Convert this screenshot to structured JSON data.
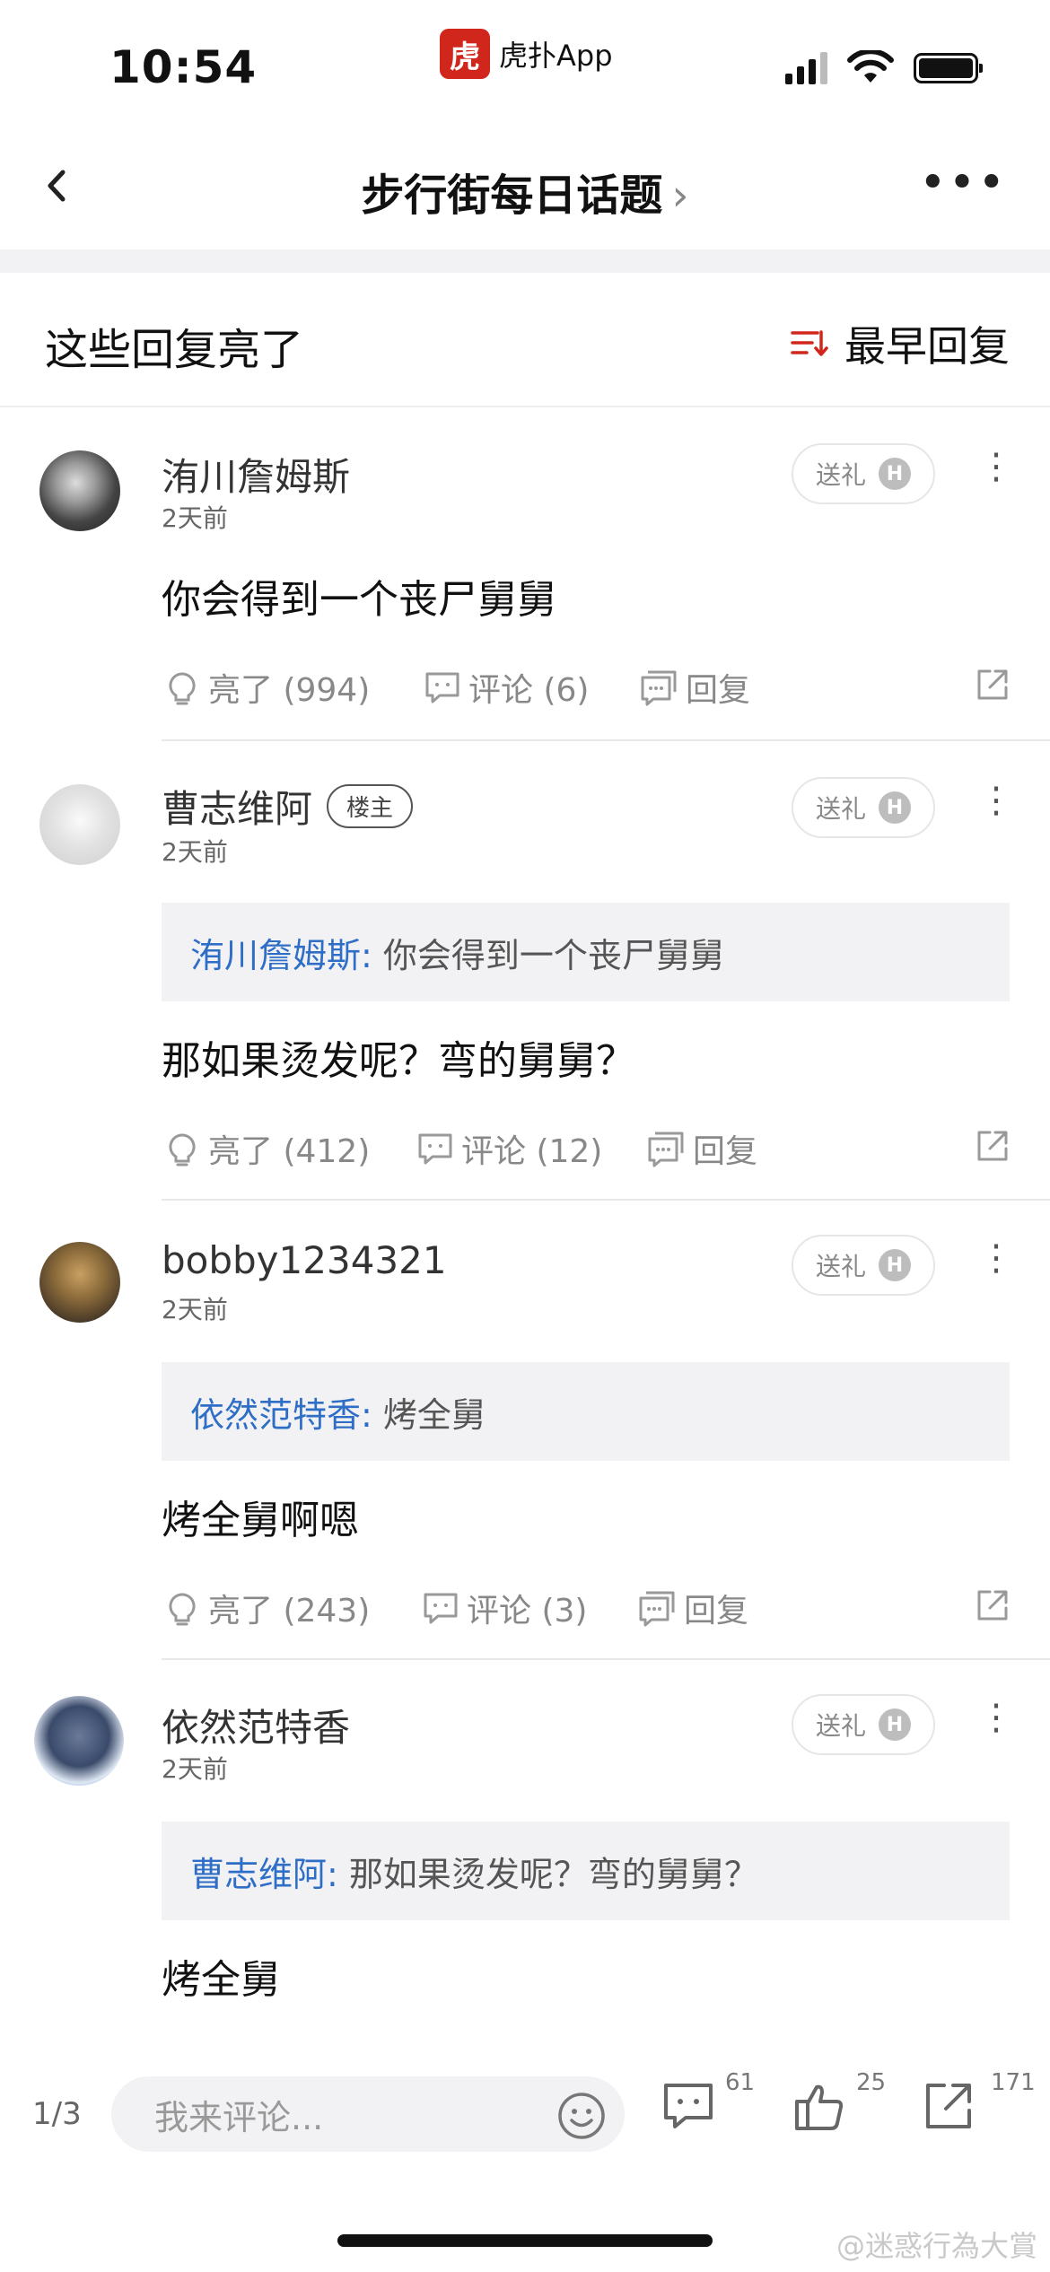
{
  "status_bar": {
    "time": "10:54",
    "app_logo_text": "虎",
    "app_name": "虎扑App"
  },
  "nav": {
    "back_icon": "chevron-left-icon",
    "title": "步行街每日话题",
    "title_chevron": "›",
    "more": "•••"
  },
  "section": {
    "title": "这些回复亮了",
    "sort_label": "最早回复",
    "sort_icon": "sort-icon",
    "accent": "#d0261c"
  },
  "labels": {
    "gift": "送礼",
    "gift_h": "H",
    "owner": "楼主",
    "reply": "回复"
  },
  "replies": [
    {
      "user": "洧川詹姆斯",
      "time": "2天前",
      "content": "你会得到一个丧尸舅舅",
      "likes": "亮了 (994)",
      "comments": "评论 (6)"
    },
    {
      "user": "曹志维阿",
      "is_owner": true,
      "time": "2天前",
      "quote_user": "洧川詹姆斯:",
      "quote_text": "你会得到一个丧尸舅舅",
      "content": "那如果烫发呢？弯的舅舅？",
      "likes": "亮了 (412)",
      "comments": "评论 (12)"
    },
    {
      "user": "bobby1234321",
      "time": "2天前",
      "quote_user": "依然范特香:",
      "quote_text": "烤全舅",
      "content": "烤全舅啊嗯",
      "likes": "亮了 (243)",
      "comments": "评论 (3)"
    },
    {
      "user": "依然范特香",
      "time": "2天前",
      "quote_user": "曹志维阿:",
      "quote_text": "那如果烫发呢？弯的舅舅？",
      "content": "烤全舅"
    }
  ],
  "bottom_bar": {
    "page": "1/3",
    "placeholder": "我来评论...",
    "comment_count": "61",
    "like_count": "25",
    "share_count": "171"
  },
  "watermark": "@迷惑行為大賞"
}
